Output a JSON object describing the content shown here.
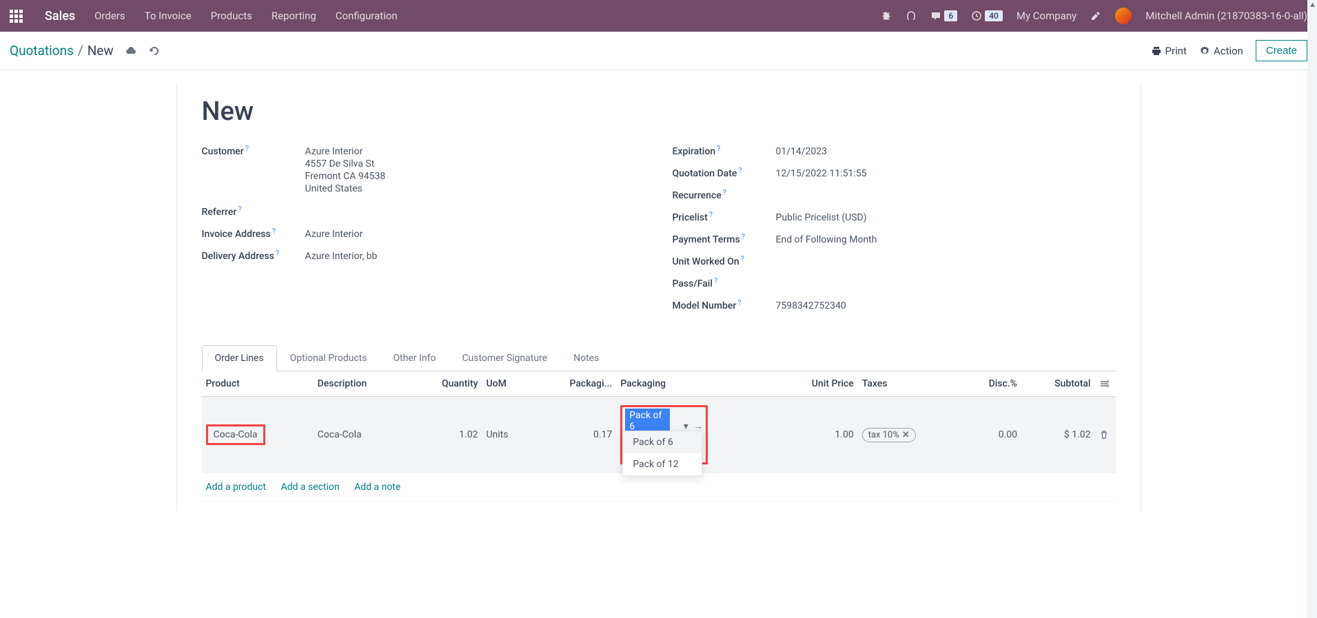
{
  "nav": {
    "brand": "Sales",
    "items": [
      "Orders",
      "To Invoice",
      "Products",
      "Reporting",
      "Configuration"
    ],
    "messages_badge": "6",
    "activities_badge": "40",
    "company": "My Company",
    "user": "Mitchell Admin (21870383-16-0-all)"
  },
  "breadcrumb": {
    "parent": "Quotations",
    "current": "New",
    "print": "Print",
    "action": "Action",
    "create": "Create"
  },
  "page": {
    "title": "New"
  },
  "left_fields": {
    "customer_label": "Customer",
    "customer_value": "Azure Interior",
    "addr1": "4557 De Silva St",
    "addr2": "Fremont CA 94538",
    "addr3": "United States",
    "referrer_label": "Referrer",
    "invoice_addr_label": "Invoice Address",
    "invoice_addr_value": "Azure Interior",
    "delivery_addr_label": "Delivery Address",
    "delivery_addr_value": "Azure Interior, bb"
  },
  "right_fields": {
    "expiration_label": "Expiration",
    "expiration_value": "01/14/2023",
    "quotation_date_label": "Quotation Date",
    "quotation_date_value": "12/15/2022 11:51:55",
    "recurrence_label": "Recurrence",
    "pricelist_label": "Pricelist",
    "pricelist_value": "Public Pricelist (USD)",
    "payment_terms_label": "Payment Terms",
    "payment_terms_value": "End of Following Month",
    "unit_worked_label": "Unit Worked On",
    "passfail_label": "Pass/Fail",
    "model_number_label": "Model Number",
    "model_number_value": "7598342752340"
  },
  "tabs": [
    "Order Lines",
    "Optional Products",
    "Other Info",
    "Customer Signature",
    "Notes"
  ],
  "columns": {
    "product": "Product",
    "description": "Description",
    "quantity": "Quantity",
    "uom": "UoM",
    "packaging_qty": "Packagi...",
    "packaging": "Packaging",
    "unit_price": "Unit Price",
    "taxes": "Taxes",
    "disc": "Disc.%",
    "subtotal": "Subtotal"
  },
  "line": {
    "product": "Coca-Cola",
    "description": "Coca-Cola",
    "quantity": "1.02",
    "uom": "Units",
    "packaging_qty": "0.17",
    "packaging": "Pack of 6",
    "unit_price": "1.00",
    "tax": "tax 10%",
    "disc": "0.00",
    "subtotal": "$ 1.02"
  },
  "dropdown": {
    "opt1": "Pack of 6",
    "opt2": "Pack of 12"
  },
  "add": {
    "product": "Add a product",
    "section": "Add a section",
    "note": "Add a note"
  }
}
